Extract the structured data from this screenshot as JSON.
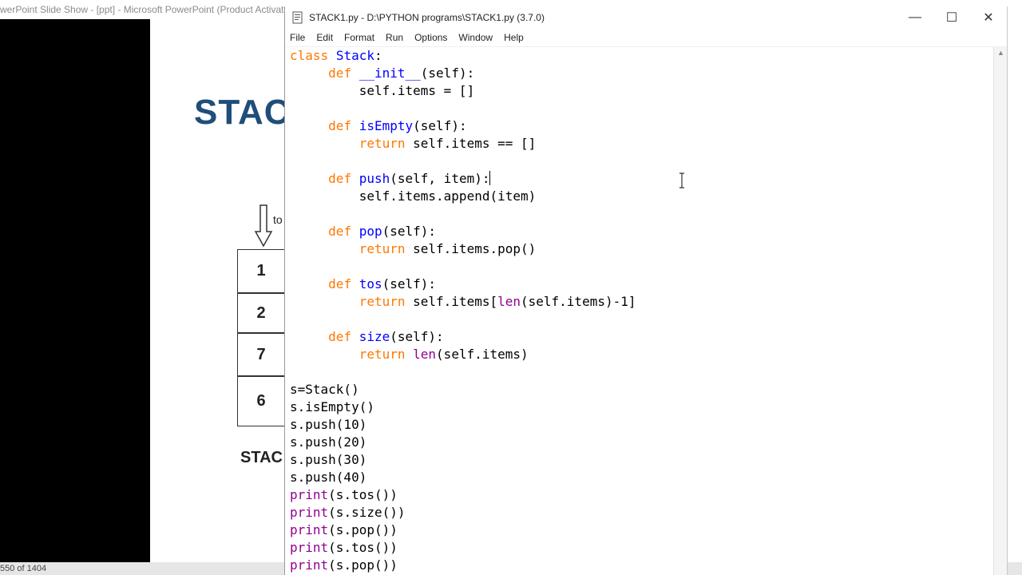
{
  "background_window": {
    "title": "werPoint Slide Show - [ppt] - Microsoft PowerPoint (Product Activat",
    "slide": {
      "heading": "STAC",
      "top_label": "to",
      "stack_items": [
        "1",
        "2",
        "7",
        "6"
      ],
      "caption": "STAC"
    },
    "status": "550 of 1404"
  },
  "editor_window": {
    "title": "STACK1.py - D:\\PYTHON programs\\STACK1.py (3.7.0)",
    "controls": {
      "minimize": "—",
      "maximize": "☐",
      "close": "✕"
    },
    "menu": [
      "File",
      "Edit",
      "Format",
      "Run",
      "Options",
      "Window",
      "Help"
    ]
  },
  "code": {
    "class_line": {
      "kw": "class",
      "name": "Stack",
      "rest": ":"
    },
    "init_def": {
      "kw": "def",
      "name": "__init__",
      "rest": "(self):"
    },
    "init_body": "self.items = []",
    "isempty_def": {
      "kw": "def",
      "name": "isEmpty",
      "rest": "(self):"
    },
    "isempty_body": {
      "kw": "return",
      "rest": " self.items == []"
    },
    "push_def": {
      "kw": "def",
      "name": "push",
      "rest": "(self, item):"
    },
    "push_body": "self.items.append(item)",
    "pop_def": {
      "kw": "def",
      "name": "pop",
      "rest": "(self):"
    },
    "pop_body": {
      "kw": "return",
      "rest": " self.items.pop()"
    },
    "tos_def": {
      "kw": "def",
      "name": "tos",
      "rest": "(self):"
    },
    "tos_body": {
      "kw": "return",
      "pre": " self.items[",
      "bi": "len",
      "post": "(self.items)-1]"
    },
    "size_def": {
      "kw": "def",
      "name": "size",
      "rest": "(self):"
    },
    "size_body": {
      "kw": "return",
      "pre": " ",
      "bi": "len",
      "post": "(self.items)"
    },
    "script": [
      "s=Stack()",
      "s.isEmpty()",
      "s.push(10)",
      "s.push(20)",
      "s.push(30)",
      "s.push(40)"
    ],
    "prints": [
      {
        "bi": "print",
        "rest": "(s.tos())"
      },
      {
        "bi": "print",
        "rest": "(s.size())"
      },
      {
        "bi": "print",
        "rest": "(s.pop())"
      },
      {
        "bi": "print",
        "rest": "(s.tos())"
      },
      {
        "bi": "print",
        "rest": "(s.pop())"
      }
    ]
  },
  "colors": {
    "keyword": "#ff7700",
    "definition": "#0000ff",
    "builtin": "#900090",
    "slide_heading": "#1f4e79"
  }
}
